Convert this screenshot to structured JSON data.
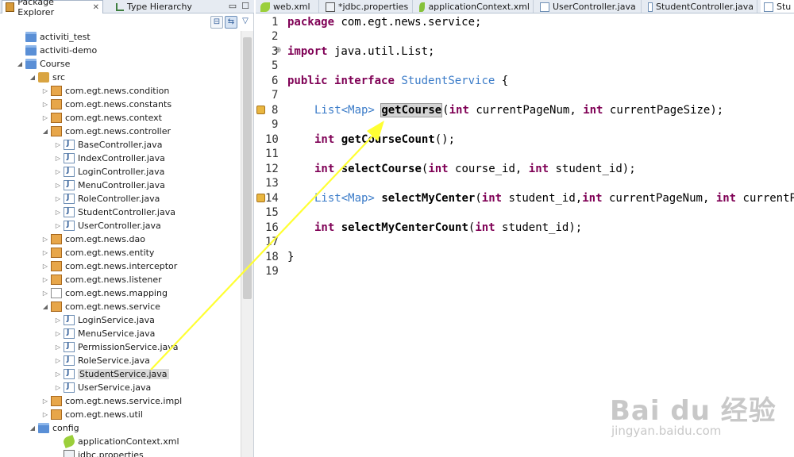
{
  "left_panel": {
    "tabs": [
      {
        "label": "Package Explorer",
        "icon": "package-explorer-icon",
        "active": true
      },
      {
        "label": "Type Hierarchy",
        "icon": "type-hierarchy-icon",
        "active": false
      }
    ],
    "close_glyph": "✕",
    "minimize_glyph": "▭",
    "maximize_glyph": "☐",
    "toolbar": {
      "collapse_glyph": "⊟",
      "link_glyph": "⇆",
      "menu_glyph": "▽"
    }
  },
  "tree": [
    {
      "label": "activiti_test",
      "icon": "project-folder-icon",
      "twist": ""
    },
    {
      "label": "activiti-demo",
      "icon": "project-folder-icon",
      "twist": ""
    },
    {
      "label": "Course",
      "icon": "project-folder-icon",
      "twist": "◢"
    },
    {
      "label": "src",
      "icon": "source-folder-icon",
      "twist": "◢"
    },
    {
      "label": "com.egt.news.condition",
      "icon": "package-icon",
      "twist": "▷"
    },
    {
      "label": "com.egt.news.constants",
      "icon": "package-icon",
      "twist": "▷"
    },
    {
      "label": "com.egt.news.context",
      "icon": "package-icon",
      "twist": "▷"
    },
    {
      "label": "com.egt.news.controller",
      "icon": "package-icon",
      "twist": "◢"
    },
    {
      "label": "BaseController.java",
      "icon": "java-file-icon",
      "twist": "▷"
    },
    {
      "label": "IndexController.java",
      "icon": "java-file-icon",
      "twist": "▷"
    },
    {
      "label": "LoginController.java",
      "icon": "java-file-icon",
      "twist": "▷"
    },
    {
      "label": "MenuController.java",
      "icon": "java-file-icon",
      "twist": "▷"
    },
    {
      "label": "RoleController.java",
      "icon": "java-file-icon",
      "twist": "▷"
    },
    {
      "label": "StudentController.java",
      "icon": "java-file-icon",
      "twist": "▷"
    },
    {
      "label": "UserController.java",
      "icon": "java-file-icon",
      "twist": "▷"
    },
    {
      "label": "com.egt.news.dao",
      "icon": "package-icon",
      "twist": "▷"
    },
    {
      "label": "com.egt.news.entity",
      "icon": "package-icon",
      "twist": "▷"
    },
    {
      "label": "com.egt.news.interceptor",
      "icon": "package-icon",
      "twist": "▷"
    },
    {
      "label": "com.egt.news.listener",
      "icon": "package-icon",
      "twist": "▷"
    },
    {
      "label": "com.egt.news.mapping",
      "icon": "empty-package-icon",
      "twist": "▷"
    },
    {
      "label": "com.egt.news.service",
      "icon": "package-icon",
      "twist": "◢"
    },
    {
      "label": "LoginService.java",
      "icon": "java-file-icon",
      "twist": "▷"
    },
    {
      "label": "MenuService.java",
      "icon": "java-file-icon",
      "twist": "▷"
    },
    {
      "label": "PermissionService.java",
      "icon": "java-file-icon",
      "twist": "▷"
    },
    {
      "label": "RoleService.java",
      "icon": "java-file-icon",
      "twist": "▷"
    },
    {
      "label": "StudentService.java",
      "icon": "java-file-icon",
      "twist": "▷",
      "selected": true
    },
    {
      "label": "UserService.java",
      "icon": "java-file-icon",
      "twist": "▷"
    },
    {
      "label": "com.egt.news.service.impl",
      "icon": "package-icon",
      "twist": "▷"
    },
    {
      "label": "com.egt.news.util",
      "icon": "package-icon",
      "twist": "▷"
    },
    {
      "label": "config",
      "icon": "folder-icon",
      "twist": "◢"
    },
    {
      "label": "applicationContext.xml",
      "icon": "xml-file-icon",
      "twist": ""
    },
    {
      "label": "jdbc.properties",
      "icon": "properties-file-icon",
      "twist": ""
    }
  ],
  "editor_tabs": [
    {
      "label": "web.xml",
      "icon": "xml-file-icon"
    },
    {
      "label": "*jdbc.properties",
      "icon": "properties-file-icon"
    },
    {
      "label": "applicationContext.xml",
      "icon": "spring-xml-icon"
    },
    {
      "label": "UserController.java",
      "icon": "java-file-icon"
    },
    {
      "label": "StudentController.java",
      "icon": "java-file-icon"
    },
    {
      "label": "Stu",
      "icon": "java-file-icon",
      "active": true
    }
  ],
  "code": {
    "line_numbers": [
      "1",
      "2",
      "3",
      "5",
      "6",
      "7",
      "8",
      "9",
      "10",
      "11",
      "12",
      "13",
      "14",
      "15",
      "16",
      "17",
      "18",
      "19"
    ],
    "lines": {
      "l1": {
        "kw": "package",
        "rest": " com.egt.news.service;"
      },
      "l3": {
        "kw": "import",
        "rest": " java.util.List;"
      },
      "l6": {
        "kw1": "public",
        "kw2": "interface",
        "name": "StudentService",
        "rest": " {"
      },
      "l8": {
        "ret": "List",
        "gen": "<Map>",
        "name": "getCourse",
        "open": "(",
        "kw1": "int",
        "p1": " currentPageNum, ",
        "kw2": "int",
        "p2": " currentPageSize);"
      },
      "l10": {
        "kw": "int",
        "name": "getCourseCount",
        "rest": "();"
      },
      "l12": {
        "kw": "int",
        "name": "selectCourse",
        "open": "(",
        "kw1": "int",
        "p1": " course_id, ",
        "kw2": "int",
        "p2": " student_id);"
      },
      "l14": {
        "ret": "List",
        "gen": "<Map>",
        "name": "selectMyCenter",
        "open": "(",
        "kw1": "int",
        "p1": " student_id,",
        "kw2": "int",
        "p2": " currentPageNum, ",
        "kw3": "int",
        "p3": " currentP"
      },
      "l16": {
        "kw": "int",
        "name": "selectMyCenterCount",
        "open": "(",
        "kw1": "int",
        "p1": " student_id);"
      },
      "l18": {
        "rest": "}"
      }
    }
  },
  "watermark": {
    "brand": "Bai du 经验",
    "url": "jingyan.baidu.com"
  },
  "colors": {
    "keyword": "#7f0055",
    "type": "#3a7bc8",
    "annotation_arrow": "#ffff33"
  }
}
